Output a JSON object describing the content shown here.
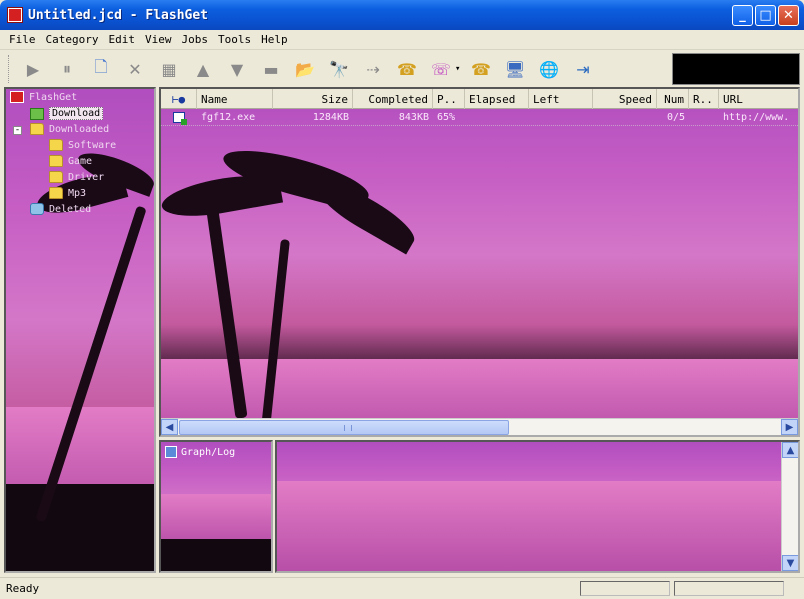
{
  "window": {
    "title": "Untitled.jcd - FlashGet",
    "controls": [
      "minimize",
      "maximize",
      "close"
    ]
  },
  "menu": [
    "File",
    "Category",
    "Edit",
    "View",
    "Jobs",
    "Tools",
    "Help"
  ],
  "toolbar": {
    "buttons": [
      {
        "name": "start-icon",
        "glyph": "▶"
      },
      {
        "name": "pause-icon",
        "glyph": "⏸"
      },
      {
        "name": "new-job-icon",
        "glyph": "🗋"
      },
      {
        "name": "delete-icon",
        "glyph": "✕"
      },
      {
        "name": "properties-icon",
        "glyph": "▦"
      },
      {
        "name": "move-up-icon",
        "glyph": "▲"
      },
      {
        "name": "move-down-icon",
        "glyph": "▼"
      },
      {
        "name": "card-icon",
        "glyph": "▬"
      },
      {
        "name": "open-folder-icon",
        "glyph": "📂"
      },
      {
        "name": "find-icon",
        "glyph": "🔭"
      },
      {
        "name": "connect-icon",
        "glyph": "⇢"
      },
      {
        "name": "dial-icon",
        "glyph": "☎"
      },
      {
        "name": "hangup-icon",
        "glyph": "☏"
      },
      {
        "name": "schedule-icon",
        "glyph": "☎"
      },
      {
        "name": "site-manager-icon",
        "glyph": "🖥"
      },
      {
        "name": "web-icon",
        "glyph": "🌐"
      },
      {
        "name": "exit-icon",
        "glyph": "⇥"
      }
    ]
  },
  "tree": {
    "root": "FlashGet",
    "items": [
      {
        "label": "Download",
        "selected": true
      },
      {
        "label": "Downloaded"
      },
      {
        "label": "Software"
      },
      {
        "label": "Game"
      },
      {
        "label": "Driver"
      },
      {
        "label": "Mp3"
      },
      {
        "label": "Deleted"
      }
    ]
  },
  "list": {
    "columns": [
      "",
      "Name",
      "Size",
      "Completed",
      "P..",
      "Elapsed",
      "Left",
      "Speed",
      "Num",
      "R..",
      "URL"
    ],
    "rows": [
      {
        "name": "fgf12.exe",
        "size": "1284KB",
        "completed": "843KB",
        "percent": "65%",
        "elapsed": "",
        "left": "",
        "speed": "",
        "num": "0/5",
        "retries": "",
        "url": "http://www."
      }
    ]
  },
  "graph": {
    "label": "Graph/Log"
  },
  "status": {
    "text": "Ready"
  }
}
